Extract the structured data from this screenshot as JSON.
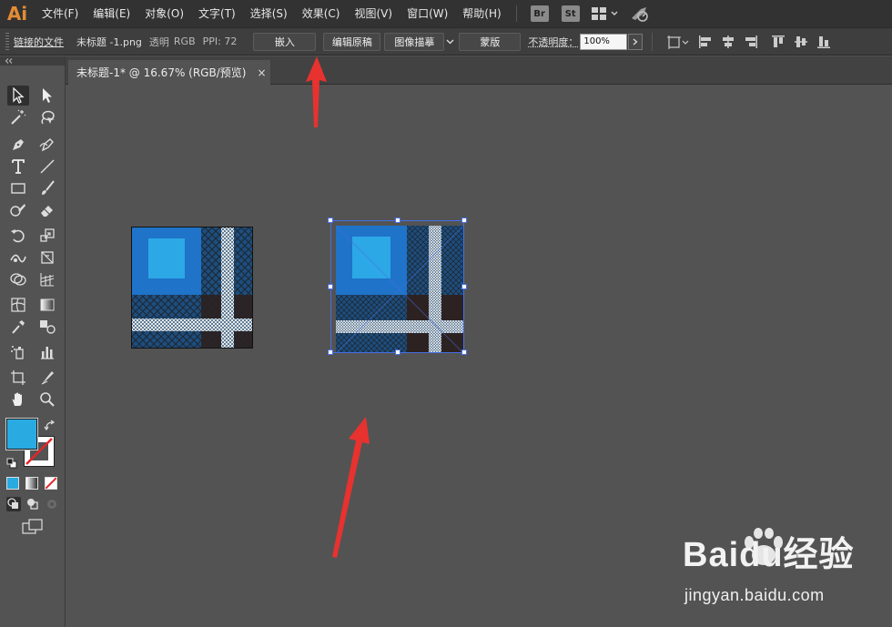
{
  "menubar": {
    "logo": "Ai",
    "items": [
      "文件(F)",
      "编辑(E)",
      "对象(O)",
      "文字(T)",
      "选择(S)",
      "效果(C)",
      "视图(V)",
      "窗口(W)",
      "帮助(H)"
    ],
    "apps": [
      "Br",
      "St"
    ]
  },
  "control_bar": {
    "linked_file_label": "链接的文件",
    "file_name": "未标题 -1.png",
    "transparency": "透明",
    "color_mode": "RGB",
    "ppi": "PPI: 72",
    "embed_button": "嵌入",
    "edit_original_button": "编辑原稿",
    "image_trace_button": "图像描摹",
    "mask_button": "蒙版",
    "opacity_label": "不透明度：",
    "opacity_value": "100%"
  },
  "document_tab": {
    "title": "未标题-1* @ 16.67% (RGB/预览)",
    "close_glyph": "×"
  },
  "tools": {
    "fill_color": "#29abe2",
    "stroke": "none"
  },
  "watermark": {
    "brand": "Baidu经验",
    "url": "jingyan.baidu.com"
  },
  "colors": {
    "menubar_bg": "#323232",
    "canvas_bg": "#535353",
    "accent_orange": "#e38c34",
    "selection_blue": "#4670e6",
    "arrow_red": "#e8322f"
  }
}
